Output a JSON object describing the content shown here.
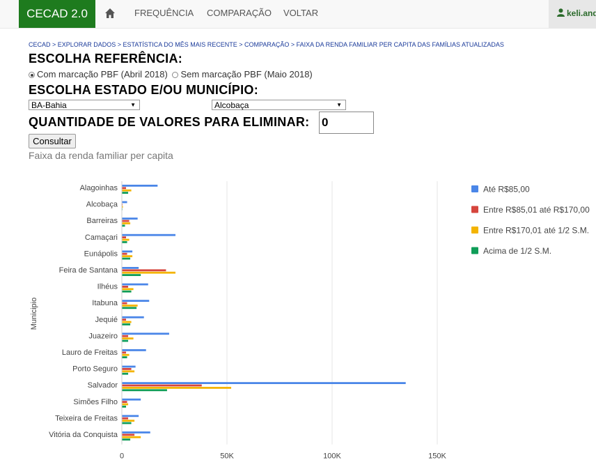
{
  "nav": {
    "brand": "CECAD 2.0",
    "items": [
      "FREQUÊNCIA",
      "COMPARAÇÃO",
      "VOLTAR"
    ],
    "user": "keli.and"
  },
  "breadcrumb": "CECAD > EXPLORAR DADOS > ESTATÍSTICA DO MÊS MAIS RECENTE > COMPARAÇÃO > FAIXA DA RENDA FAMILIAR PER CAPITA DAS FAMÍLIAS ATUALIZADAS",
  "form": {
    "ref_title": "ESCOLHA REFERÊNCIA:",
    "ref_option_1": "Com marcação PBF (Abril 2018)",
    "ref_option_2": "Sem marcação PBF (Maio 2018)",
    "state_title": "ESCOLHA ESTADO E/OU MUNICÍPIO:",
    "state_value": "BA-Bahia",
    "municipality_value": "Alcobaça",
    "qty_title": "QUANTIDADE DE VALORES PARA ELIMINAR:",
    "qty_value": "0",
    "submit_label": "Consultar"
  },
  "chart_title": "Faixa da renda familiar per capita",
  "colors": {
    "s1": "#4a86e8",
    "s2": "#d6453d",
    "s3": "#f4b400",
    "s4": "#0f9d58",
    "grid": "#e5e5e5"
  },
  "chart_data": {
    "type": "bar",
    "orientation": "horizontal",
    "ylabel": "Municipio",
    "xlim": [
      0,
      150000
    ],
    "x_ticks": [
      "0",
      "50K",
      "100K",
      "150K"
    ],
    "legend_position": "right",
    "categories": [
      "Alagoinhas",
      "Alcobaça",
      "Barreiras",
      "Camaçari",
      "Eunápolis",
      "Feira de Santana",
      "Ilhéus",
      "Itabuna",
      "Jequié",
      "Juazeiro",
      "Lauro de Freitas",
      "Porto Seguro",
      "Salvador",
      "Simões Filho",
      "Teixeira de Freitas",
      "Vitória da Conquista"
    ],
    "series": [
      {
        "name": "Até R$85,00",
        "values": [
          17000,
          2500,
          7500,
          25500,
          5000,
          8000,
          12500,
          13000,
          10500,
          22500,
          11500,
          6500,
          135000,
          9000,
          8000,
          13500
        ]
      },
      {
        "name": "Entre R$85,01 até R$170,00",
        "values": [
          2000,
          300,
          3500,
          2000,
          2500,
          21000,
          3000,
          2500,
          2000,
          3000,
          2000,
          4500,
          38000,
          2500,
          3000,
          6000
        ]
      },
      {
        "name": "Entre R$170,01 até 1/2 S.M.",
        "values": [
          4500,
          500,
          4000,
          3500,
          5000,
          25500,
          5500,
          7500,
          4500,
          5500,
          3500,
          6000,
          52000,
          3000,
          6000,
          9000
        ]
      },
      {
        "name": "Acima de 1/2 S.M.",
        "values": [
          3000,
          200,
          1500,
          2500,
          4000,
          9000,
          4500,
          7000,
          4000,
          3000,
          2500,
          3000,
          21500,
          2000,
          4500,
          4000
        ]
      }
    ]
  }
}
